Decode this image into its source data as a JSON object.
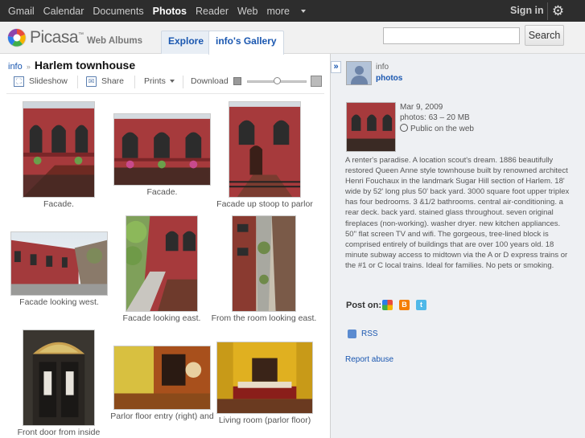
{
  "topnav": {
    "items": [
      "Gmail",
      "Calendar",
      "Documents",
      "Photos",
      "Reader",
      "Web",
      "more"
    ],
    "active": "Photos",
    "signin": "Sign in",
    "settings_icon": "gear-icon"
  },
  "header": {
    "logo_text": "Picasa",
    "logo_tm": "™",
    "logo_sub": "Web Albums",
    "tabs": [
      {
        "label": "Explore"
      },
      {
        "label": "info's Gallery"
      }
    ],
    "search": {
      "value": "",
      "placeholder": "",
      "button": "Search"
    }
  },
  "album": {
    "breadcrumb_owner": "info",
    "breadcrumb_sep": "»",
    "title": "Harlem townhouse",
    "toolbar": {
      "slideshow": "Slideshow",
      "share": "Share",
      "prints": "Prints",
      "download": "Download"
    },
    "zoom_level": 0.5,
    "photos": [
      {
        "caption": "Facade."
      },
      {
        "caption": "Facade."
      },
      {
        "caption": "Facade up stoop to parlor"
      },
      {
        "caption": "Facade looking west."
      },
      {
        "caption": "Facade looking east."
      },
      {
        "caption": "From the room looking east."
      },
      {
        "caption": "Front door from inside"
      },
      {
        "caption": "Parlor floor entry (right) and"
      },
      {
        "caption": "Living room (parlor floor)"
      }
    ]
  },
  "sidebar": {
    "owner_name": "info",
    "owner_link": "photos",
    "date": "Mar 9, 2009",
    "photos_count": "photos: 63 – 20 MB",
    "visibility": "Public on the web",
    "description": "A renter's paradise. A location scout's dream. 1886 beautifully restored Queen Anne style townhouse built by renowned architect Henri Fouchaux in the landmark Sugar Hill section of Harlem. 18' wide by 52' long plus 50' back yard. 3000 square foot upper triplex has four bedrooms. 3 &1/2 bathrooms. central air-conditioning. a rear deck. back yard. stained glass throughout. seven original fireplaces (non-working). washer dryer. new kitchen appliances. 50\" flat screen TV and wifi. The gorgeous, tree-lined block is comprised entirely of buildings that are over 100 years old. 18 minute subway access to midtown via the A or D express trains or the #1 or C local trains. Ideal for families. No pets or smoking.",
    "post_on": "Post on:",
    "rss": "RSS",
    "report": "Report abuse"
  },
  "colors": {
    "accent": "#1a57b0",
    "topbar": "#2d2d2d",
    "brick": "#a8383c"
  }
}
